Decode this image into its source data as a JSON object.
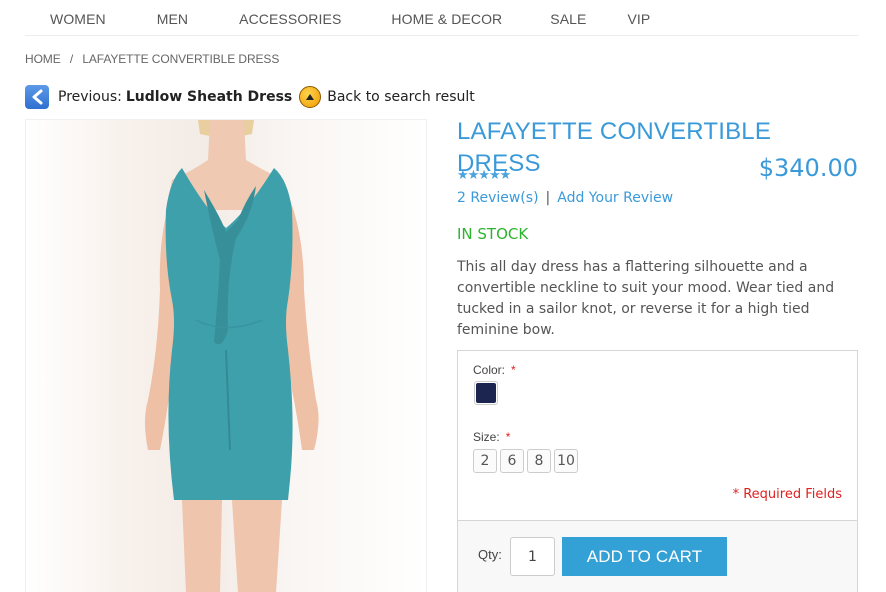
{
  "nav": {
    "items": [
      "WOMEN",
      "MEN",
      "ACCESSORIES",
      "HOME & DECOR",
      "SALE",
      "VIP"
    ]
  },
  "breadcrumb": {
    "home": "HOME",
    "separator": "/",
    "current": "LAFAYETTE CONVERTIBLE DRESS"
  },
  "prev_nav": {
    "prev_icon": "chevron-left-icon",
    "label": "Previous:",
    "previous_product": "Ludlow Sheath Dress",
    "back_icon": "up-arrow-circle-icon",
    "back_label": "Back to search result"
  },
  "product": {
    "image_alt": "Model wearing teal sleeveless dress with tie neckline",
    "title": "LAFAYETTE CONVERTIBLE DRESS",
    "price": "$340.00",
    "rating": {
      "stars": 5,
      "max": 5,
      "glyphs": "★★★★★"
    },
    "reviews_link": "2 Review(s)",
    "review_separator": "|",
    "add_review_link": "Add Your Review",
    "stock": "IN STOCK",
    "description": "This all day dress has a flattering silhouette and a convertible neckline to suit your mood. Wear tied and tucked in a sailor knot, or reverse it for a high tied feminine bow."
  },
  "options": {
    "color_label": "Color:",
    "size_label": "Size:",
    "required_marker": "*",
    "color_swatches": [
      {
        "name": "Navy",
        "hex": "#1b2550"
      }
    ],
    "sizes": [
      "2",
      "6",
      "8",
      "10"
    ],
    "required_fields_note": "* Required Fields"
  },
  "cart": {
    "qty_label": "Qty:",
    "qty_value": "1",
    "add_to_cart_label": "ADD TO CART"
  },
  "colors": {
    "accent": "#3a9ad9",
    "button": "#33a0d6",
    "in_stock": "#2db32d",
    "required": "#e02020"
  }
}
